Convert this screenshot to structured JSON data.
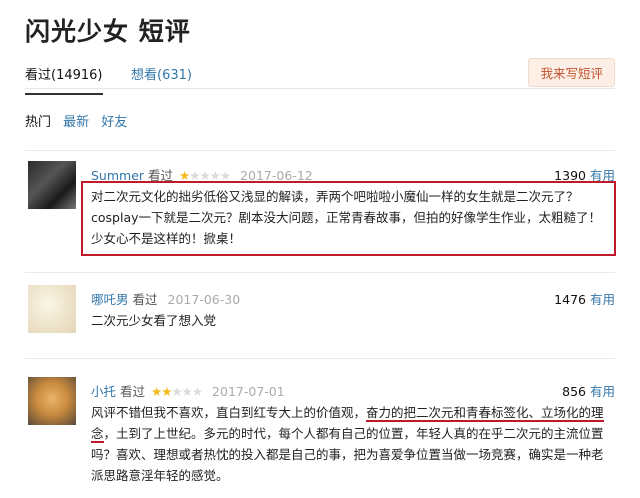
{
  "page": {
    "title": "闪光少女 短评"
  },
  "tabs": {
    "watched": "看过(14916)",
    "want": "想看(631)",
    "write_button": "我来写短评"
  },
  "sorts": {
    "hot": "热门",
    "latest": "最新",
    "friends": "好友"
  },
  "comments": [
    {
      "author": "Summer",
      "status": "看过",
      "rating": 1,
      "date": "2017-06-12",
      "votes": "1390",
      "useful": "有用",
      "text": "对二次元文化的拙劣低俗又浅显的解读，弄两个吧啦啦小魔仙一样的女生就是二次元了？cosplay一下就是二次元？剧本没大问题，正常青春故事，但拍的好像学生作业，太粗糙了！少女心不是这样的！掀桌！"
    },
    {
      "author": "哪吒男",
      "status": "看过",
      "date": "2017-06-30",
      "votes": "1476",
      "useful": "有用",
      "text": "二次元少女看了想入党"
    },
    {
      "author": "小托",
      "status": "看过",
      "rating": 2,
      "date": "2017-07-01",
      "votes": "856",
      "useful": "有用",
      "text_before": "风评不错但我不喜欢，直白到红专大上的价值观，",
      "text_underlined": "奋力的把二次元和青春标签化、立场化的理念",
      "text_after": "，土到了上世纪。多元的时代，每个人都有自己的位置，年轻人真的在乎二次元的主流位置吗？喜欢、理想或者热忱的投入都是自己的事，把为喜爱争位置当做一场竞赛，确实是一种老派思路意淫年轻的感觉。"
    }
  ],
  "colors": {
    "link": "#3377aa",
    "star": "#f5b91c",
    "highlight": "#c01a2a",
    "write_button_bg": "#fdeee6",
    "write_button_text": "#c0552f"
  }
}
